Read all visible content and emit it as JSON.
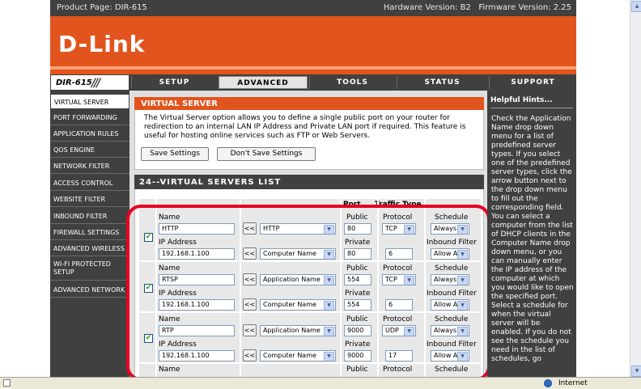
{
  "header": {
    "product_page": "Product Page: DIR-615",
    "versions": "Hardware Version: B2   Firmware Version: 2.25",
    "logo": "D-Link",
    "model": "DIR-615"
  },
  "tabs": [
    "SETUP",
    "ADVANCED",
    "TOOLS",
    "STATUS",
    "SUPPORT"
  ],
  "active_tab": "ADVANCED",
  "sidebar": {
    "items": [
      "VIRTUAL SERVER",
      "PORT FORWARDING",
      "APPLICATION RULES",
      "QOS ENGINE",
      "NETWORK FILTER",
      "ACCESS CONTROL",
      "WEBSITE FILTER",
      "INBOUND FILTER",
      "FIREWALL SETTINGS",
      "ADVANCED WIRELESS",
      "WI-FI PROTECTED SETUP",
      "ADVANCED NETWORK"
    ]
  },
  "virtual_server": {
    "title": "VIRTUAL SERVER",
    "description": "The Virtual Server option allows you to define a single public port on your router for redirection to an internal LAN IP Address and Private LAN port if required. This feature is useful for hosting online services such as FTP or Web Servers.",
    "save_label": "Save Settings",
    "dont_save_label": "Don't Save Settings"
  },
  "list": {
    "title": "24--VIRTUAL SERVERS LIST",
    "col_port": "Port",
    "col_traffic": "Traffic Type",
    "labels": {
      "name": "Name",
      "ip": "IP Address",
      "public": "Public",
      "private": "Private",
      "protocol": "Protocol",
      "schedule": "Schedule",
      "inbound": "Inbound Filter",
      "copy": "<<"
    },
    "rows": [
      {
        "checked": true,
        "name": "HTTP",
        "app": "HTTP",
        "ip": "192.168.1.100",
        "computer": "Computer Name",
        "public_port": "80",
        "private_port": "80",
        "protocol_num": "6",
        "protocol": "TCP",
        "schedule": "Always",
        "inbound": "Allow All"
      },
      {
        "checked": true,
        "name": "RTSP",
        "app": "Application Name",
        "ip": "192.168.1.100",
        "computer": "Computer Name",
        "public_port": "554",
        "private_port": "554",
        "protocol_num": "6",
        "protocol": "TCP",
        "schedule": "Always",
        "inbound": "Allow All"
      },
      {
        "checked": true,
        "name": "RTP",
        "app": "Application Name",
        "ip": "192.168.1.100",
        "computer": "Computer Name",
        "public_port": "9000",
        "private_port": "9000",
        "protocol_num": "17",
        "protocol": "UDP",
        "schedule": "Always",
        "inbound": "Allow All"
      }
    ]
  },
  "hints": {
    "title": "Helpful Hints...",
    "text": "Check the Application Name drop down menu for a list of predefined server types. If you select one of the predefined server types, click the arrow button next to the drop down menu to fill out the corresponding field. You can select a computer from the list of DHCP clients in the Computer Name drop down menu, or you can manually enter the IP address of the computer at which you would like to open the specified port. Select a schedule for when the virtual server will be enabled. If you do not see the schedule you need in the list of schedules, go"
  },
  "statusbar": {
    "zone": "Internet"
  }
}
